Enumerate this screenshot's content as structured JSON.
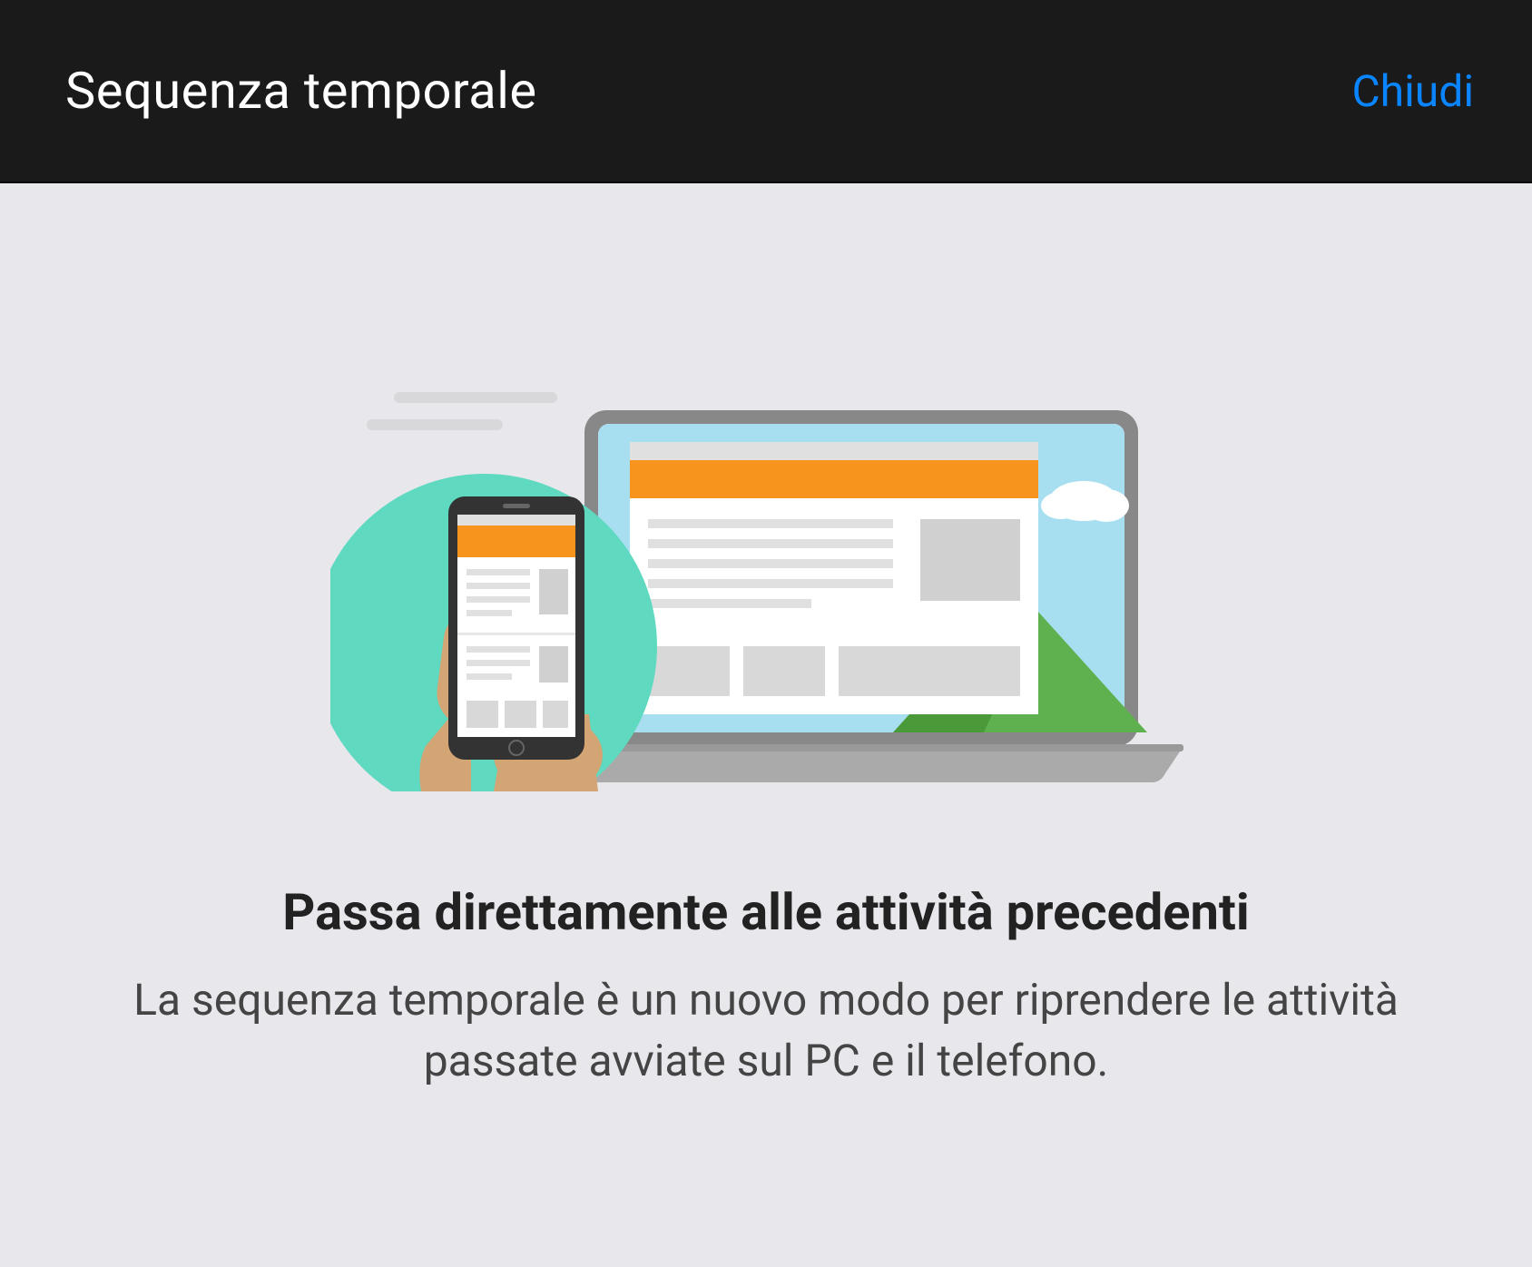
{
  "header": {
    "title": "Sequenza temporale",
    "close_label": "Chiudi"
  },
  "content": {
    "title": "Passa direttamente alle attività precedenti",
    "description": "La sequenza temporale è un nuovo modo per riprendere le attività passate avviate sul PC e il telefono."
  }
}
